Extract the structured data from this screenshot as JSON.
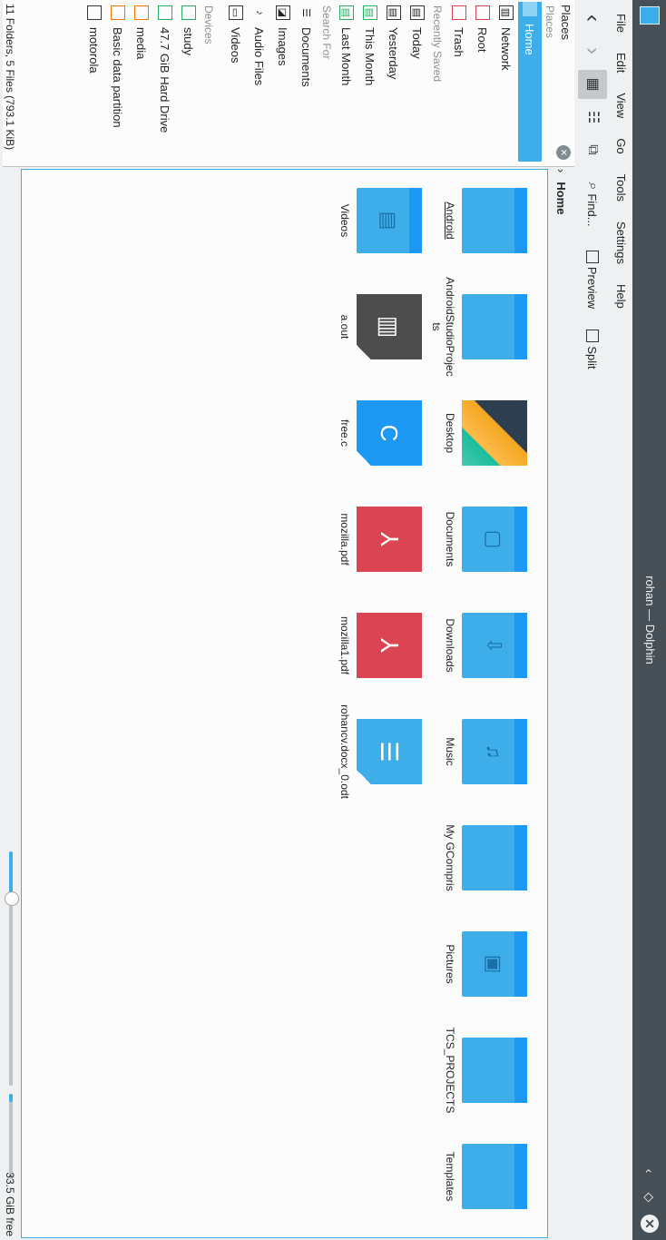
{
  "window": {
    "title": "rohan — Dolphin",
    "close_glyph": "✕",
    "keep_glyph": "◇",
    "min_glyph": "‹"
  },
  "menu": [
    "File",
    "Edit",
    "View",
    "Go",
    "Tools",
    "Settings",
    "Help"
  ],
  "toolbar": {
    "back_glyph": "‹",
    "forward_glyph": "›",
    "find_label": "Find...",
    "preview_label": "Preview",
    "split_label": "Split"
  },
  "places": {
    "panel_title": "Places",
    "section_places": "Places",
    "home": "Home",
    "network": "Network",
    "root": "Root",
    "trash": "Trash",
    "section_recent": "Recently Saved",
    "today": "Today",
    "yesterday": "Yesterday",
    "this_month": "This Month",
    "last_month": "Last Month",
    "section_search": "Search For",
    "documents": "Documents",
    "images": "Images",
    "audio_files": "Audio Files",
    "videos": "Videos",
    "section_devices": "Devices",
    "study": "study",
    "hard_drive": "47.7 GiB Hard Drive",
    "media": "media",
    "basic_partition": "Basic data partition",
    "motorola": "motorola"
  },
  "breadcrumb": {
    "separator": "›",
    "current": "Home"
  },
  "files": {
    "android": "Android",
    "androidstudio": "AndroidStudioProjects",
    "desktop": "Desktop",
    "documents": "Documents",
    "downloads": "Downloads",
    "music": "Music",
    "mygcompris": "My GCompris",
    "pictures": "Pictures",
    "tcs_projects": "TCS_PROJECTS",
    "templates": "Templates",
    "videos": "Videos",
    "aout": "a.out",
    "freec": "free.c",
    "mozilla_pdf": "mozilla.pdf",
    "mozilla1_pdf": "mozilla1.pdf",
    "rohancv": "rohancv.docx_0.odt"
  },
  "status": {
    "summary": "11 Folders, 5 Files (793.1 KiB)",
    "free_space": "33.5 GiB free",
    "zoom_level": 0.2,
    "space_used_fraction": 0.1
  },
  "colors": {
    "accent": "#3daee9",
    "titlebar": "#475057",
    "pdf": "#da4453"
  }
}
